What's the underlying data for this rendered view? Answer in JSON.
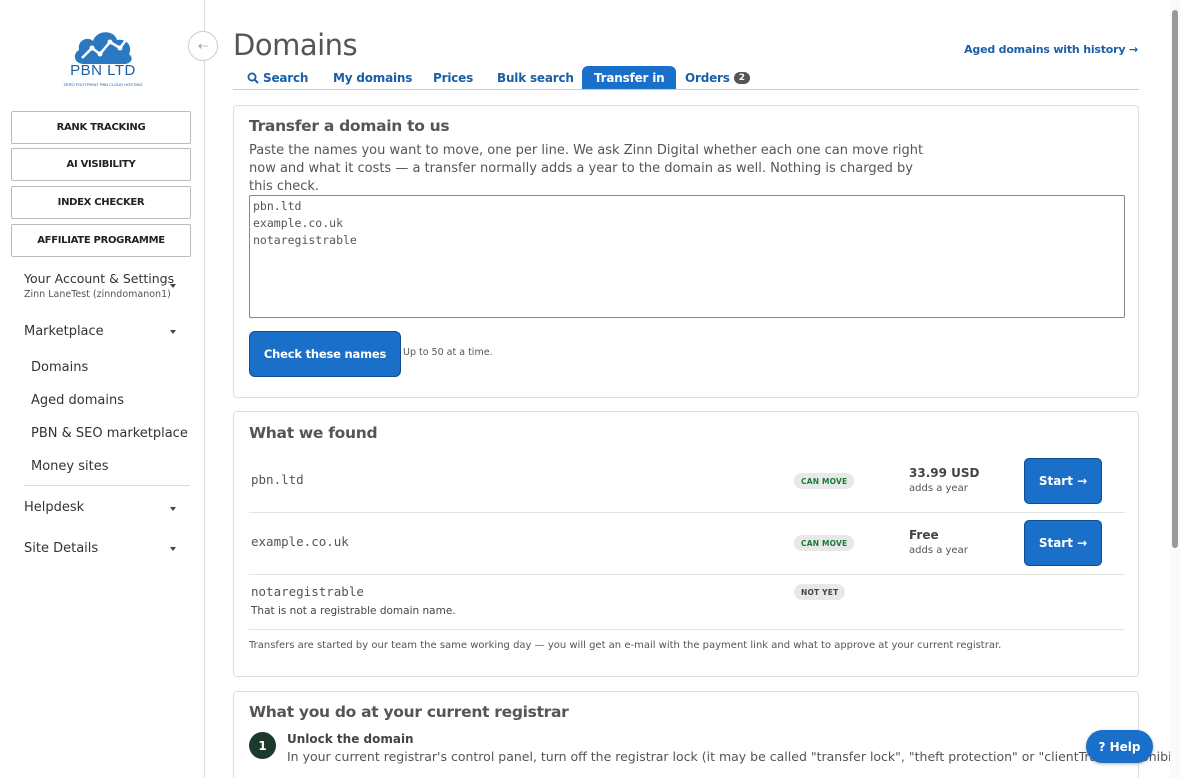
{
  "sidebar": {
    "logo": {
      "name": "PBN LTD",
      "tagline": "ZERO FOOTPRINT PBN CLOUD HOSTING"
    },
    "buttons": [
      "RANK TRACKING",
      "AI VISIBILITY",
      "INDEX CHECKER",
      "AFFILIATE PROGRAMME"
    ],
    "account": {
      "title": "Your Account & Settings",
      "user": "Zinn LaneTest (zinndomanon1)"
    },
    "marketplace": {
      "label": "Marketplace",
      "items": [
        "Domains",
        "Aged domains",
        "PBN & SEO marketplace",
        "Money sites"
      ]
    },
    "helpdesk": "Helpdesk",
    "site_details": "Site Details"
  },
  "header": {
    "title": "Domains",
    "aged_link": "Aged domains with history →"
  },
  "tabs": [
    {
      "label": "Search",
      "icon": "search-icon"
    },
    {
      "label": "My domains"
    },
    {
      "label": "Prices"
    },
    {
      "label": "Bulk search"
    },
    {
      "label": "Transfer in",
      "active": true
    },
    {
      "label": "Orders",
      "badge": "2"
    }
  ],
  "transfer": {
    "title": "Transfer a domain to us",
    "intro": "Paste the names you want to move, one per line. We ask Zinn Digital whether each one can move right now and what it costs — a transfer normally adds a year to the domain as well. Nothing is charged by this check.",
    "textarea_value": "pbn.ltd\nexample.co.uk\nnotaregistrable",
    "check_button": "Check these names",
    "hint": "Up to 50 at a time."
  },
  "results": {
    "title": "What we found",
    "rows": [
      {
        "domain": "pbn.ltd",
        "status": "CAN MOVE",
        "price": "33.99 USD",
        "price_note": "adds a year",
        "button": "Start →"
      },
      {
        "domain": "example.co.uk",
        "status": "CAN MOVE",
        "price": "Free",
        "price_note": "adds a year",
        "button": "Start →"
      },
      {
        "domain": "notaregistrable",
        "status": "NOT YET",
        "note": "That is not a registrable domain name."
      }
    ],
    "footnote": "Transfers are started by our team the same working day — you will get an e-mail with the payment link and what to approve at your current registrar."
  },
  "registrar": {
    "title": "What you do at your current registrar",
    "steps": [
      {
        "num": "1",
        "title": "Unlock the domain",
        "text": "In your current registrar's control panel, turn off the registrar lock (it may be called \"transfer lock\", \"theft protection\" or \"clientTransferProhibited\")."
      }
    ]
  },
  "help_button": "? Help",
  "colors": {
    "accent": "#1a6fc9",
    "link": "#1a5fa8",
    "success": "#1b7a3a"
  }
}
